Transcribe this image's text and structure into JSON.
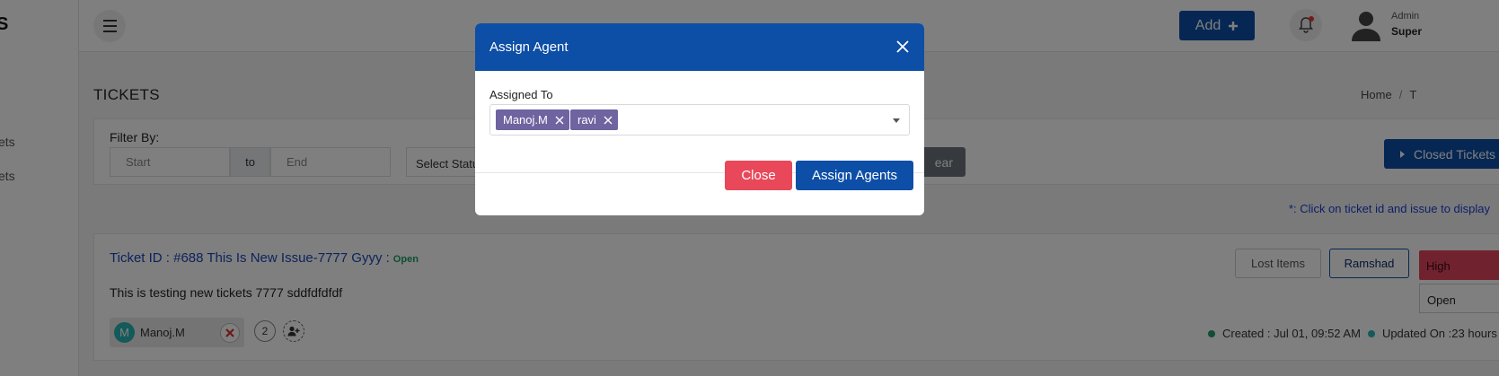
{
  "sidebar": {
    "brand": "S",
    "items": [
      {
        "label": "ets"
      },
      {
        "label": "ets"
      }
    ]
  },
  "header": {
    "add_label": "Add",
    "user_role": "Admin",
    "user_name": "Super"
  },
  "page": {
    "title": "TICKETS",
    "breadcrumb": [
      "Home",
      "/",
      "T"
    ]
  },
  "filter": {
    "label": "Filter By:",
    "start_placeholder": "Start",
    "to_label": "to",
    "end_placeholder": "End",
    "status_placeholder": "Select Status",
    "clear_label": "ear",
    "closed_tickets_label": "Closed Tickets"
  },
  "hint": "*: Click on ticket id and issue to display",
  "ticket": {
    "title": "Ticket ID : #688 This Is New Issue-7777 Gyyy :",
    "status": "Open",
    "description": "This is testing new tickets 7777 sddfdfdfdf",
    "agent_initial": "M",
    "agent_name": "Manoj.M",
    "agent_count": "2",
    "lost_items_label": "Lost Items",
    "assignee_label": "Ramshad",
    "priority": "High",
    "status_select": "Open",
    "created": "Created : Jul 01, 09:52 AM",
    "updated": "Updated On :23 hours",
    "colors": {
      "created_dot": "#1f9d6b",
      "updated_dot": "#28b5b5"
    }
  },
  "modal": {
    "title": "Assign Agent",
    "field_label": "Assigned To",
    "selected": [
      {
        "label": "Manoj.M"
      },
      {
        "label": "ravi"
      }
    ],
    "close_label": "Close",
    "assign_label": "Assign Agents"
  },
  "colors": {
    "primary": "#0d4ea6",
    "danger": "#e8485a",
    "tag": "#6f63a0"
  }
}
